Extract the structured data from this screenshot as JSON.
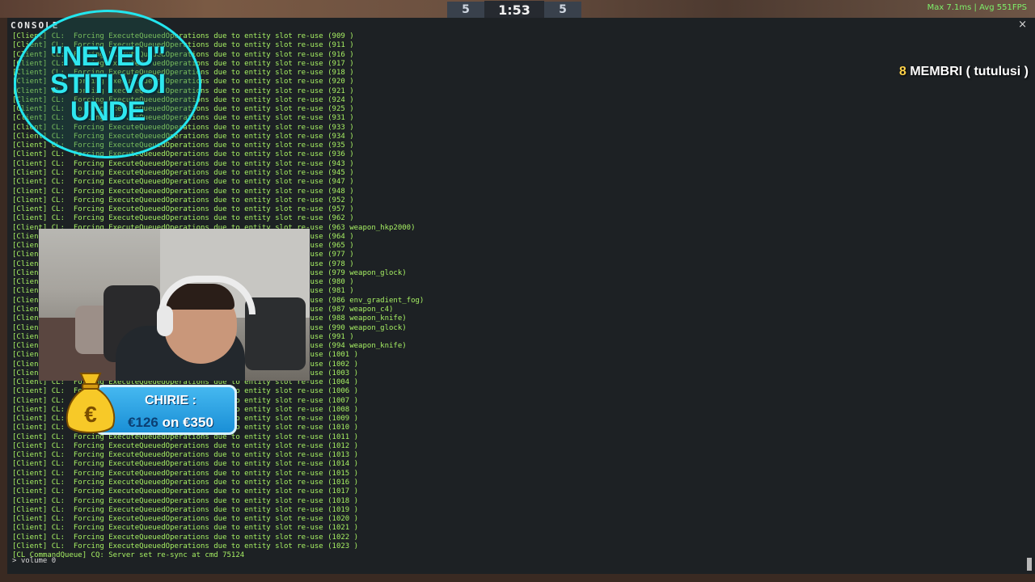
{
  "hud": {
    "team_left_score": "5",
    "timer": "1:53",
    "team_right_score": "5",
    "perf": "Max  7.1ms | Avg  551FPS"
  },
  "console": {
    "title": "CONSOLE",
    "close": "×",
    "lines": [
      "[Client] CL:  Forcing ExecuteQueuedOperations due to entity slot re-use (909 )",
      "[Client] CL:  Forcing ExecuteQueuedOperations due to entity slot re-use (911 )",
      "[Client] CL:  Forcing ExecuteQueuedOperations due to entity slot re-use (916 )",
      "[Client] CL:  Forcing ExecuteQueuedOperations due to entity slot re-use (917 )",
      "[Client] CL:  Forcing ExecuteQueuedOperations due to entity slot re-use (918 )",
      "[Client] CL:  Forcing ExecuteQueuedOperations due to entity slot re-use (920 )",
      "[Client] CL:  Forcing ExecuteQueuedOperations due to entity slot re-use (921 )",
      "[Client] CL:  Forcing ExecuteQueuedOperations due to entity slot re-use (924 )",
      "[Client] CL:  Forcing ExecuteQueuedOperations due to entity slot re-use (925 )",
      "[Client] CL:  Forcing ExecuteQueuedOperations due to entity slot re-use (931 )",
      "[Client] CL:  Forcing ExecuteQueuedOperations due to entity slot re-use (933 )",
      "[Client] CL:  Forcing ExecuteQueuedOperations due to entity slot re-use (934 )",
      "[Client] CL:  Forcing ExecuteQueuedOperations due to entity slot re-use (935 )",
      "[Client] CL:  Forcing ExecuteQueuedOperations due to entity slot re-use (936 )",
      "[Client] CL:  Forcing ExecuteQueuedOperations due to entity slot re-use (943 )",
      "[Client] CL:  Forcing ExecuteQueuedOperations due to entity slot re-use (945 )",
      "[Client] CL:  Forcing ExecuteQueuedOperations due to entity slot re-use (947 )",
      "[Client] CL:  Forcing ExecuteQueuedOperations due to entity slot re-use (948 )",
      "[Client] CL:  Forcing ExecuteQueuedOperations due to entity slot re-use (952 )",
      "[Client] CL:  Forcing ExecuteQueuedOperations due to entity slot re-use (957 )",
      "[Client] CL:  Forcing ExecuteQueuedOperations due to entity slot re-use (962 )",
      "[Client] CL:  Forcing ExecuteQueuedOperations due to entity slot re-use (963 weapon_hkp2000)",
      "[Client] CL:  Forcing ExecuteQueuedOperations due to entity slot re-use (964 )",
      "[Client] CL:  Forcing ExecuteQueuedOperations due to entity slot re-use (965 )",
      "[Client] CL:  Forcing ExecuteQueuedOperations due to entity slot re-use (977 )",
      "[Client] CL:  Forcing ExecuteQueuedOperations due to entity slot re-use (978 )",
      "[Client] CL:  Forcing ExecuteQueuedOperations due to entity slot re-use (979 weapon_glock)",
      "[Client] CL:  Forcing ExecuteQueuedOperations due to entity slot re-use (980 )",
      "[Client] CL:  Forcing ExecuteQueuedOperations due to entity slot re-use (981 )",
      "[Client] CL:  Forcing ExecuteQueuedOperations due to entity slot re-use (986 env_gradient_fog)",
      "[Client] CL:  Forcing ExecuteQueuedOperations due to entity slot re-use (987 weapon_c4)",
      "[Client] CL:  Forcing ExecuteQueuedOperations due to entity slot re-use (988 weapon_knife)",
      "[Client] CL:  Forcing ExecuteQueuedOperations due to entity slot re-use (990 weapon_glock)",
      "[Client] CL:  Forcing ExecuteQueuedOperations due to entity slot re-use (991 )",
      "[Client] CL:  Forcing ExecuteQueuedOperations due to entity slot re-use (994 weapon_knife)",
      "[Client] CL:  Forcing ExecuteQueuedOperations due to entity slot re-use (1001 )",
      "[Client] CL:  Forcing ExecuteQueuedOperations due to entity slot re-use (1002 )",
      "[Client] CL:  Forcing ExecuteQueuedOperations due to entity slot re-use (1003 )",
      "[Client] CL:  Forcing ExecuteQueuedOperations due to entity slot re-use (1004 )",
      "[Client] CL:  Forcing ExecuteQueuedOperations due to entity slot re-use (1006 )",
      "[Client] CL:  Forcing ExecuteQueuedOperations due to entity slot re-use (1007 )",
      "[Client] CL:  Forcing ExecuteQueuedOperations due to entity slot re-use (1008 )",
      "[Client] CL:  Forcing ExecuteQueuedOperations due to entity slot re-use (1009 )",
      "[Client] CL:  Forcing ExecuteQueuedOperations due to entity slot re-use (1010 )",
      "[Client] CL:  Forcing ExecuteQueuedOperations due to entity slot re-use (1011 )",
      "[Client] CL:  Forcing ExecuteQueuedOperations due to entity slot re-use (1012 )",
      "[Client] CL:  Forcing ExecuteQueuedOperations due to entity slot re-use (1013 )",
      "[Client] CL:  Forcing ExecuteQueuedOperations due to entity slot re-use (1014 )",
      "[Client] CL:  Forcing ExecuteQueuedOperations due to entity slot re-use (1015 )",
      "[Client] CL:  Forcing ExecuteQueuedOperations due to entity slot re-use (1016 )",
      "[Client] CL:  Forcing ExecuteQueuedOperations due to entity slot re-use (1017 )",
      "[Client] CL:  Forcing ExecuteQueuedOperations due to entity slot re-use (1018 )",
      "[Client] CL:  Forcing ExecuteQueuedOperations due to entity slot re-use (1019 )",
      "[Client] CL:  Forcing ExecuteQueuedOperations due to entity slot re-use (1020 )",
      "[Client] CL:  Forcing ExecuteQueuedOperations due to entity slot re-use (1021 )",
      "[Client] CL:  Forcing ExecuteQueuedOperations due to entity slot re-use (1022 )",
      "[Client] CL:  Forcing ExecuteQueuedOperations due to entity slot re-use (1023 )",
      "[CL CommandQueue] CQ: Server set re-sync at cmd 75124"
    ],
    "input": "> volume 0"
  },
  "overlay": {
    "badge_lines": [
      "\"NEVEU\"",
      "STITI VOI",
      "UNDE"
    ],
    "members_count": "8",
    "members_text": " MEMBRI ( tutulusi )",
    "donation_name": "CHIRIE :",
    "donation_current": "€126",
    "donation_rest": " on €350"
  },
  "colors": {
    "log_text": "#a6ef63",
    "badge_cyan": "#2fe7ef",
    "donation_blue": "#1a8fd6"
  }
}
